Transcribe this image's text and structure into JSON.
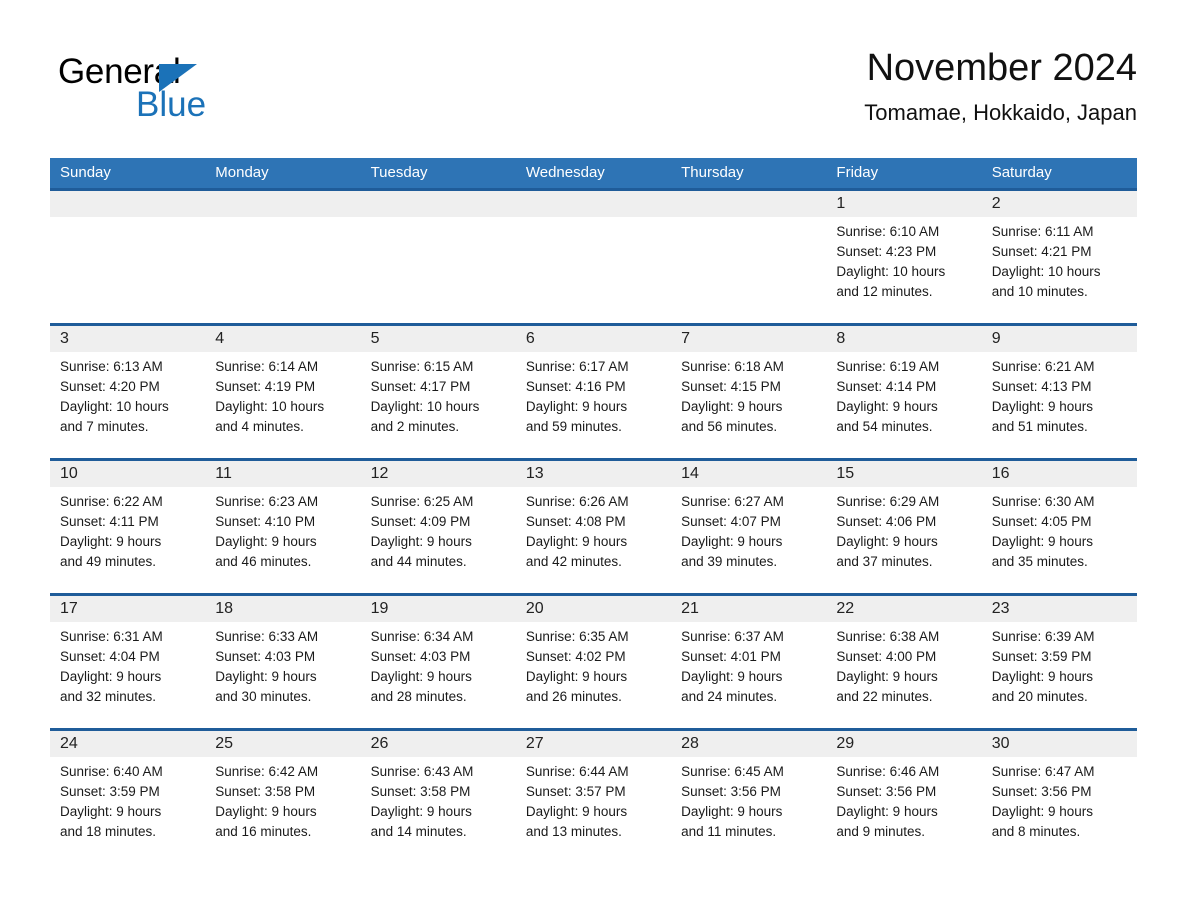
{
  "brand": {
    "word_one": "General",
    "word_two": "Blue",
    "triangle_icon": "triangle-icon",
    "accent_color": "#1b72b8"
  },
  "header": {
    "title": "November 2024",
    "location": "Tomamae, Hokkaido, Japan"
  },
  "theme": {
    "header_row_bg": "#2e74b5",
    "row_top_border": "#1f5c99",
    "date_band_bg": "#efefef",
    "cell_bg": "#ffffff",
    "text_color": "#1a1a1a"
  },
  "weekdays": [
    "Sunday",
    "Monday",
    "Tuesday",
    "Wednesday",
    "Thursday",
    "Friday",
    "Saturday"
  ],
  "weeks": [
    [
      {
        "day": "",
        "lines": []
      },
      {
        "day": "",
        "lines": []
      },
      {
        "day": "",
        "lines": []
      },
      {
        "day": "",
        "lines": []
      },
      {
        "day": "",
        "lines": []
      },
      {
        "day": "1",
        "lines": [
          "Sunrise: 6:10 AM",
          "Sunset: 4:23 PM",
          "Daylight: 10 hours",
          "and 12 minutes."
        ]
      },
      {
        "day": "2",
        "lines": [
          "Sunrise: 6:11 AM",
          "Sunset: 4:21 PM",
          "Daylight: 10 hours",
          "and 10 minutes."
        ]
      }
    ],
    [
      {
        "day": "3",
        "lines": [
          "Sunrise: 6:13 AM",
          "Sunset: 4:20 PM",
          "Daylight: 10 hours",
          "and 7 minutes."
        ]
      },
      {
        "day": "4",
        "lines": [
          "Sunrise: 6:14 AM",
          "Sunset: 4:19 PM",
          "Daylight: 10 hours",
          "and 4 minutes."
        ]
      },
      {
        "day": "5",
        "lines": [
          "Sunrise: 6:15 AM",
          "Sunset: 4:17 PM",
          "Daylight: 10 hours",
          "and 2 minutes."
        ]
      },
      {
        "day": "6",
        "lines": [
          "Sunrise: 6:17 AM",
          "Sunset: 4:16 PM",
          "Daylight: 9 hours",
          "and 59 minutes."
        ]
      },
      {
        "day": "7",
        "lines": [
          "Sunrise: 6:18 AM",
          "Sunset: 4:15 PM",
          "Daylight: 9 hours",
          "and 56 minutes."
        ]
      },
      {
        "day": "8",
        "lines": [
          "Sunrise: 6:19 AM",
          "Sunset: 4:14 PM",
          "Daylight: 9 hours",
          "and 54 minutes."
        ]
      },
      {
        "day": "9",
        "lines": [
          "Sunrise: 6:21 AM",
          "Sunset: 4:13 PM",
          "Daylight: 9 hours",
          "and 51 minutes."
        ]
      }
    ],
    [
      {
        "day": "10",
        "lines": [
          "Sunrise: 6:22 AM",
          "Sunset: 4:11 PM",
          "Daylight: 9 hours",
          "and 49 minutes."
        ]
      },
      {
        "day": "11",
        "lines": [
          "Sunrise: 6:23 AM",
          "Sunset: 4:10 PM",
          "Daylight: 9 hours",
          "and 46 minutes."
        ]
      },
      {
        "day": "12",
        "lines": [
          "Sunrise: 6:25 AM",
          "Sunset: 4:09 PM",
          "Daylight: 9 hours",
          "and 44 minutes."
        ]
      },
      {
        "day": "13",
        "lines": [
          "Sunrise: 6:26 AM",
          "Sunset: 4:08 PM",
          "Daylight: 9 hours",
          "and 42 minutes."
        ]
      },
      {
        "day": "14",
        "lines": [
          "Sunrise: 6:27 AM",
          "Sunset: 4:07 PM",
          "Daylight: 9 hours",
          "and 39 minutes."
        ]
      },
      {
        "day": "15",
        "lines": [
          "Sunrise: 6:29 AM",
          "Sunset: 4:06 PM",
          "Daylight: 9 hours",
          "and 37 minutes."
        ]
      },
      {
        "day": "16",
        "lines": [
          "Sunrise: 6:30 AM",
          "Sunset: 4:05 PM",
          "Daylight: 9 hours",
          "and 35 minutes."
        ]
      }
    ],
    [
      {
        "day": "17",
        "lines": [
          "Sunrise: 6:31 AM",
          "Sunset: 4:04 PM",
          "Daylight: 9 hours",
          "and 32 minutes."
        ]
      },
      {
        "day": "18",
        "lines": [
          "Sunrise: 6:33 AM",
          "Sunset: 4:03 PM",
          "Daylight: 9 hours",
          "and 30 minutes."
        ]
      },
      {
        "day": "19",
        "lines": [
          "Sunrise: 6:34 AM",
          "Sunset: 4:03 PM",
          "Daylight: 9 hours",
          "and 28 minutes."
        ]
      },
      {
        "day": "20",
        "lines": [
          "Sunrise: 6:35 AM",
          "Sunset: 4:02 PM",
          "Daylight: 9 hours",
          "and 26 minutes."
        ]
      },
      {
        "day": "21",
        "lines": [
          "Sunrise: 6:37 AM",
          "Sunset: 4:01 PM",
          "Daylight: 9 hours",
          "and 24 minutes."
        ]
      },
      {
        "day": "22",
        "lines": [
          "Sunrise: 6:38 AM",
          "Sunset: 4:00 PM",
          "Daylight: 9 hours",
          "and 22 minutes."
        ]
      },
      {
        "day": "23",
        "lines": [
          "Sunrise: 6:39 AM",
          "Sunset: 3:59 PM",
          "Daylight: 9 hours",
          "and 20 minutes."
        ]
      }
    ],
    [
      {
        "day": "24",
        "lines": [
          "Sunrise: 6:40 AM",
          "Sunset: 3:59 PM",
          "Daylight: 9 hours",
          "and 18 minutes."
        ]
      },
      {
        "day": "25",
        "lines": [
          "Sunrise: 6:42 AM",
          "Sunset: 3:58 PM",
          "Daylight: 9 hours",
          "and 16 minutes."
        ]
      },
      {
        "day": "26",
        "lines": [
          "Sunrise: 6:43 AM",
          "Sunset: 3:58 PM",
          "Daylight: 9 hours",
          "and 14 minutes."
        ]
      },
      {
        "day": "27",
        "lines": [
          "Sunrise: 6:44 AM",
          "Sunset: 3:57 PM",
          "Daylight: 9 hours",
          "and 13 minutes."
        ]
      },
      {
        "day": "28",
        "lines": [
          "Sunrise: 6:45 AM",
          "Sunset: 3:56 PM",
          "Daylight: 9 hours",
          "and 11 minutes."
        ]
      },
      {
        "day": "29",
        "lines": [
          "Sunrise: 6:46 AM",
          "Sunset: 3:56 PM",
          "Daylight: 9 hours",
          "and 9 minutes."
        ]
      },
      {
        "day": "30",
        "lines": [
          "Sunrise: 6:47 AM",
          "Sunset: 3:56 PM",
          "Daylight: 9 hours",
          "and 8 minutes."
        ]
      }
    ]
  ]
}
